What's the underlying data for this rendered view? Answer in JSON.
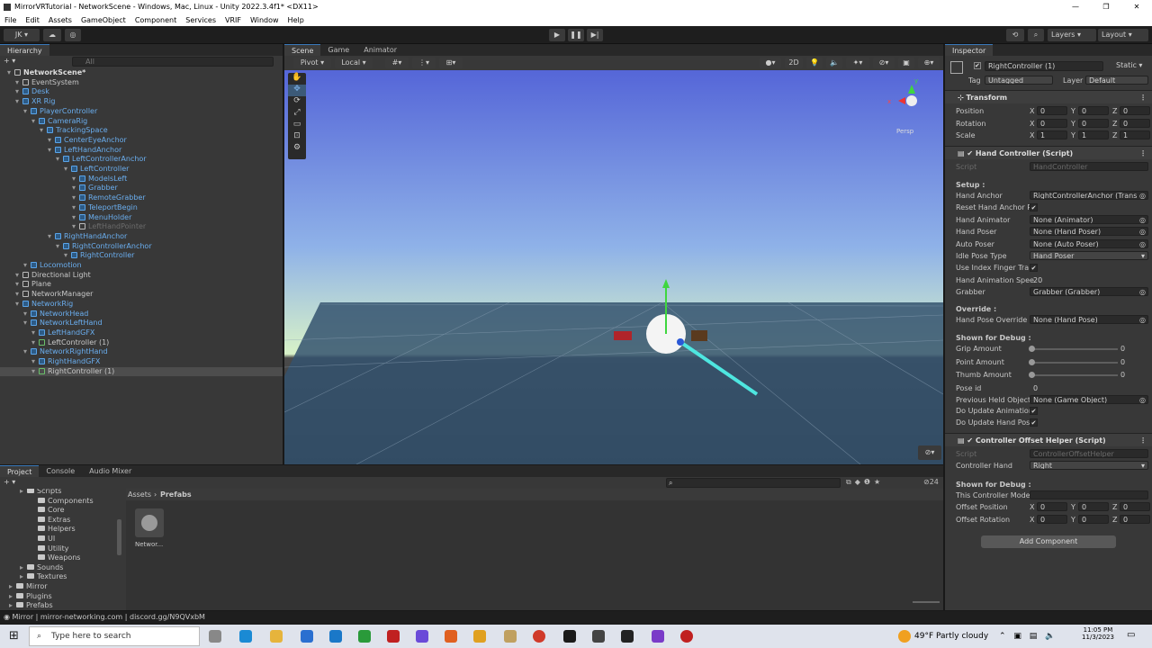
{
  "window": {
    "title": "MirrorVRTutorial - NetworkScene - Windows, Mac, Linux - Unity 2022.3.4f1* <DX11>",
    "buttons": [
      "—",
      "❐",
      "✕"
    ]
  },
  "menu": [
    "File",
    "Edit",
    "Assets",
    "GameObject",
    "Component",
    "Services",
    "VRIF",
    "Window",
    "Help"
  ],
  "toolbar": {
    "account": "JK",
    "layers": "Layers",
    "layout": "Layout"
  },
  "hierarchy": {
    "tab": "Hierarchy",
    "search_placeholder": "All",
    "rows": [
      {
        "label": "NetworkScene*",
        "depth": 0,
        "kind": "scene"
      },
      {
        "label": "EventSystem",
        "depth": 1
      },
      {
        "label": "Desk",
        "depth": 1,
        "kind": "blue"
      },
      {
        "label": "XR Rig",
        "depth": 1,
        "kind": "blue"
      },
      {
        "label": "PlayerController",
        "depth": 2,
        "kind": "blue"
      },
      {
        "label": "CameraRig",
        "depth": 3,
        "kind": "blue"
      },
      {
        "label": "TrackingSpace",
        "depth": 4,
        "kind": "blue"
      },
      {
        "label": "CenterEyeAnchor",
        "depth": 5,
        "kind": "blue"
      },
      {
        "label": "LeftHandAnchor",
        "depth": 5,
        "kind": "blue"
      },
      {
        "label": "LeftControllerAnchor",
        "depth": 6,
        "kind": "blue"
      },
      {
        "label": "LeftController",
        "depth": 7,
        "kind": "blue"
      },
      {
        "label": "ModelsLeft",
        "depth": 8,
        "kind": "blue"
      },
      {
        "label": "Grabber",
        "depth": 8,
        "kind": "blue"
      },
      {
        "label": "RemoteGrabber",
        "depth": 8,
        "kind": "blue"
      },
      {
        "label": "TeleportBegin",
        "depth": 8,
        "kind": "blue"
      },
      {
        "label": "MenuHolder",
        "depth": 8,
        "kind": "blue"
      },
      {
        "label": "LeftHandPointer",
        "depth": 8,
        "kind": "dim"
      },
      {
        "label": "RightHandAnchor",
        "depth": 5,
        "kind": "blue"
      },
      {
        "label": "RightControllerAnchor",
        "depth": 6,
        "kind": "blue"
      },
      {
        "label": "RightController",
        "depth": 7,
        "kind": "blue"
      },
      {
        "label": "Locomotion",
        "depth": 2,
        "kind": "blue"
      },
      {
        "label": "Directional Light",
        "depth": 1
      },
      {
        "label": "Plane",
        "depth": 1
      },
      {
        "label": "NetworkManager",
        "depth": 1
      },
      {
        "label": "NetworkRig",
        "depth": 1,
        "kind": "blue"
      },
      {
        "label": "NetworkHead",
        "depth": 2,
        "kind": "blue"
      },
      {
        "label": "NetworkLeftHand",
        "depth": 2,
        "kind": "blue"
      },
      {
        "label": "LeftHandGFX",
        "depth": 3,
        "kind": "blue"
      },
      {
        "label": "LeftController (1)",
        "depth": 3,
        "kind": "green"
      },
      {
        "label": "NetworkRightHand",
        "depth": 2,
        "kind": "blue"
      },
      {
        "label": "RightHandGFX",
        "depth": 3,
        "kind": "blue"
      },
      {
        "label": "RightController (1)",
        "depth": 3,
        "kind": "green",
        "selected": true
      }
    ]
  },
  "scene": {
    "tabs": [
      "Scene",
      "Game",
      "Animator"
    ],
    "pivot": "Pivot",
    "local": "Local",
    "mode_2d": "2D",
    "persp": "Persp",
    "axis_x": "x",
    "axis_y": "y"
  },
  "inspector": {
    "tab": "Inspector",
    "object_name": "RightController (1)",
    "static_label": "Static",
    "tag_label": "Tag",
    "tag_value": "Untagged",
    "layer_label": "Layer",
    "layer_value": "Default",
    "transform": {
      "title": "Transform",
      "rows": [
        {
          "label": "Position",
          "x": "0",
          "y": "0",
          "z": "0"
        },
        {
          "label": "Rotation",
          "x": "0",
          "y": "0",
          "z": "0"
        },
        {
          "label": "Scale",
          "x": "1",
          "y": "1",
          "z": "1"
        }
      ]
    },
    "hand_controller": {
      "title": "Hand Controller (Script)",
      "script_label": "Script",
      "script_value": "HandController",
      "setup": "Setup :",
      "fields": [
        {
          "label": "Hand Anchor",
          "value": "RightControllerAnchor (Trans",
          "type": "object"
        },
        {
          "label": "Reset Hand Anchor P",
          "value": "✔",
          "type": "check"
        },
        {
          "label": "Hand Animator",
          "value": "None (Animator)",
          "type": "object"
        },
        {
          "label": "Hand Poser",
          "value": "None (Hand Poser)",
          "type": "object"
        },
        {
          "label": "Auto Poser",
          "value": "None (Auto Poser)",
          "type": "object"
        },
        {
          "label": "Idle Pose Type",
          "value": "Hand Poser",
          "type": "dropdown"
        },
        {
          "label": "Use Index Finger Tra",
          "value": "✔",
          "type": "check"
        },
        {
          "label": "Hand Animation Spee",
          "value": "20",
          "type": "text"
        },
        {
          "label": "Grabber",
          "value": "Grabber (Grabber)",
          "type": "object"
        }
      ],
      "override": "Override :",
      "override_fields": [
        {
          "label": "Hand Pose Override",
          "value": "None (Hand Pose)",
          "type": "object"
        }
      ],
      "debug": "Shown for Debug :",
      "sliders": [
        {
          "label": "Grip Amount",
          "value": "0"
        },
        {
          "label": "Point Amount",
          "value": "0"
        },
        {
          "label": "Thumb Amount",
          "value": "0"
        }
      ],
      "debug_fields": [
        {
          "label": "Pose id",
          "value": "0",
          "type": "text"
        },
        {
          "label": "Previous Held Object",
          "value": "None (Game Object)",
          "type": "object"
        },
        {
          "label": "Do Update Animation",
          "value": "✔",
          "type": "check"
        },
        {
          "label": "Do Update Hand Pos",
          "value": "✔",
          "type": "check"
        }
      ]
    },
    "offset_helper": {
      "title": "Controller Offset Helper (Script)",
      "script_label": "Script",
      "script_value": "ControllerOffsetHelper",
      "controller_hand_label": "Controller Hand",
      "controller_hand_value": "Right",
      "debug": "Shown for Debug :",
      "mode_label": "This Controller Mode",
      "rows": [
        {
          "label": "Offset Position",
          "x": "0",
          "y": "0",
          "z": "0"
        },
        {
          "label": "Offset Rotation",
          "x": "0",
          "y": "0",
          "z": "0"
        }
      ]
    },
    "add_component": "Add Component"
  },
  "project": {
    "tabs": [
      "Project",
      "Console",
      "Audio Mixer"
    ],
    "folders": [
      {
        "label": "Scripts",
        "depth": 1
      },
      {
        "label": "Components",
        "depth": 2
      },
      {
        "label": "Core",
        "depth": 2
      },
      {
        "label": "Extras",
        "depth": 2
      },
      {
        "label": "Helpers",
        "depth": 2
      },
      {
        "label": "UI",
        "depth": 2
      },
      {
        "label": "Utility",
        "depth": 2
      },
      {
        "label": "Weapons",
        "depth": 2
      },
      {
        "label": "Sounds",
        "depth": 1
      },
      {
        "label": "Textures",
        "depth": 1
      },
      {
        "label": "Mirror",
        "depth": 0
      },
      {
        "label": "Plugins",
        "depth": 0
      },
      {
        "label": "Prefabs",
        "depth": 0
      }
    ],
    "breadcrumb_root": "Assets",
    "breadcrumb_leaf": "Prefabs",
    "asset_label": "Networ...",
    "count": "24"
  },
  "statusbar": {
    "text": "Mirror | mirror-networking.com | discord.gg/N9QVxbM"
  },
  "taskbar": {
    "search": "Type here to search",
    "weather_temp": "49°F",
    "weather_desc": "Partly cloudy",
    "time": "11:05 PM",
    "date": "11/3/2023"
  }
}
